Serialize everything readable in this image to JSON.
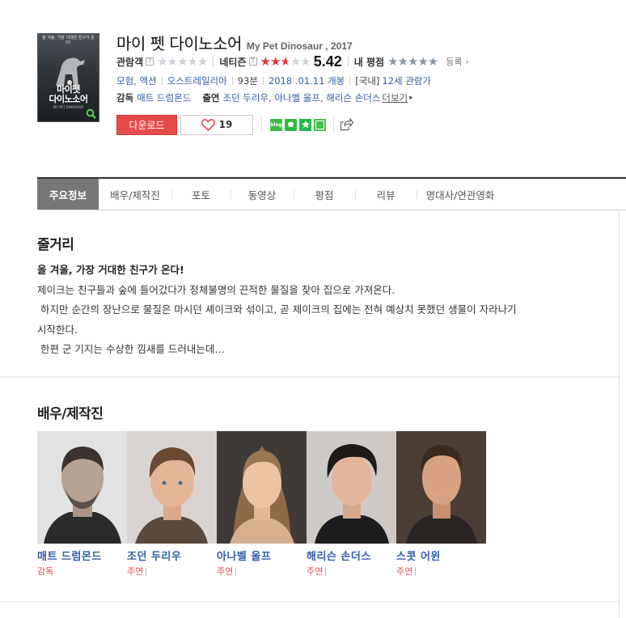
{
  "movie": {
    "title": "마이 펫 다이노소어",
    "original_title": "My Pet Dinosaur , 2017",
    "poster": {
      "tagline": "올 겨울, 가장 거대한 친구가 온다!",
      "title_line1": "마이펫",
      "title_line2": "다이노소어",
      "subtitle": "MY PET DINOSAUR",
      "zoom_icon": "magnifier-icon"
    }
  },
  "ratings": {
    "audience_label": "관람객",
    "audience_fraction": 0,
    "netizen_label": "네티즌",
    "netizen_score": "5.42",
    "netizen_fraction": 0.542,
    "my_label": "내 평점",
    "my_fraction": 0,
    "register_label": "등록",
    "help_icon": "question-icon",
    "accent_color": "#e8343c"
  },
  "meta": {
    "genre": "모험, 액션",
    "country": "오스트레일리아",
    "runtime": "93분",
    "release": "2018 .01.11 개봉",
    "rating_prefix": "[국내]",
    "rating": "12세 관람가"
  },
  "crew": {
    "director_label": "감독",
    "director": "매트 드럼몬드",
    "cast_label": "출연",
    "cast": "조던 두리우, 아나벨 울프, 해리슨 손더스",
    "more": "더보기"
  },
  "actions": {
    "download": "다운로드",
    "like_count": "19",
    "sns": [
      {
        "icon": "blog-icon",
        "label": "blog"
      },
      {
        "icon": "band-icon",
        "label": ""
      },
      {
        "icon": "bookmark-icon",
        "label": ""
      },
      {
        "icon": "cafe-icon",
        "label": ""
      }
    ],
    "share_icon": "share-icon"
  },
  "tabs": [
    {
      "label": "주요정보",
      "active": true
    },
    {
      "label": "배우/제작진",
      "active": false
    },
    {
      "label": "포토",
      "active": false
    },
    {
      "label": "동영상",
      "active": false
    },
    {
      "label": "평점",
      "active": false
    },
    {
      "label": "리뷰",
      "active": false
    },
    {
      "label": "명대사/연관영화",
      "active": false
    }
  ],
  "synopsis": {
    "heading": "줄거리",
    "tagline": "올 겨울, 가장 거대한 친구가 온다!",
    "lines": [
      "제이크는 친구들과 숲에 들어갔다가 정체불명의 끈적한 물질을 찾아 집으로 가져온다.",
      " 하지만 순간의 장난으로 물질은 마시던 셰이크와 섞이고, 곧 제이크의 집에는 전혀 예상치 못했던 생물이 자라나기",
      "시작한다.",
      " 한편 군 기지는 수상한 낌새를 드러내는데…"
    ]
  },
  "cast_section": {
    "heading": "배우/제작진",
    "people": [
      {
        "name": "매트 드럼몬드",
        "role": "감독",
        "photo_icon": "person-photo"
      },
      {
        "name": "조던 두리우",
        "role": "주연",
        "photo_icon": "person-photo"
      },
      {
        "name": "아나벨 울프",
        "role": "주연",
        "photo_icon": "person-photo"
      },
      {
        "name": "해리슨 손더스",
        "role": "주연",
        "photo_icon": "person-photo"
      },
      {
        "name": "스콧 어윈",
        "role": "주연",
        "photo_icon": "person-photo"
      }
    ]
  }
}
